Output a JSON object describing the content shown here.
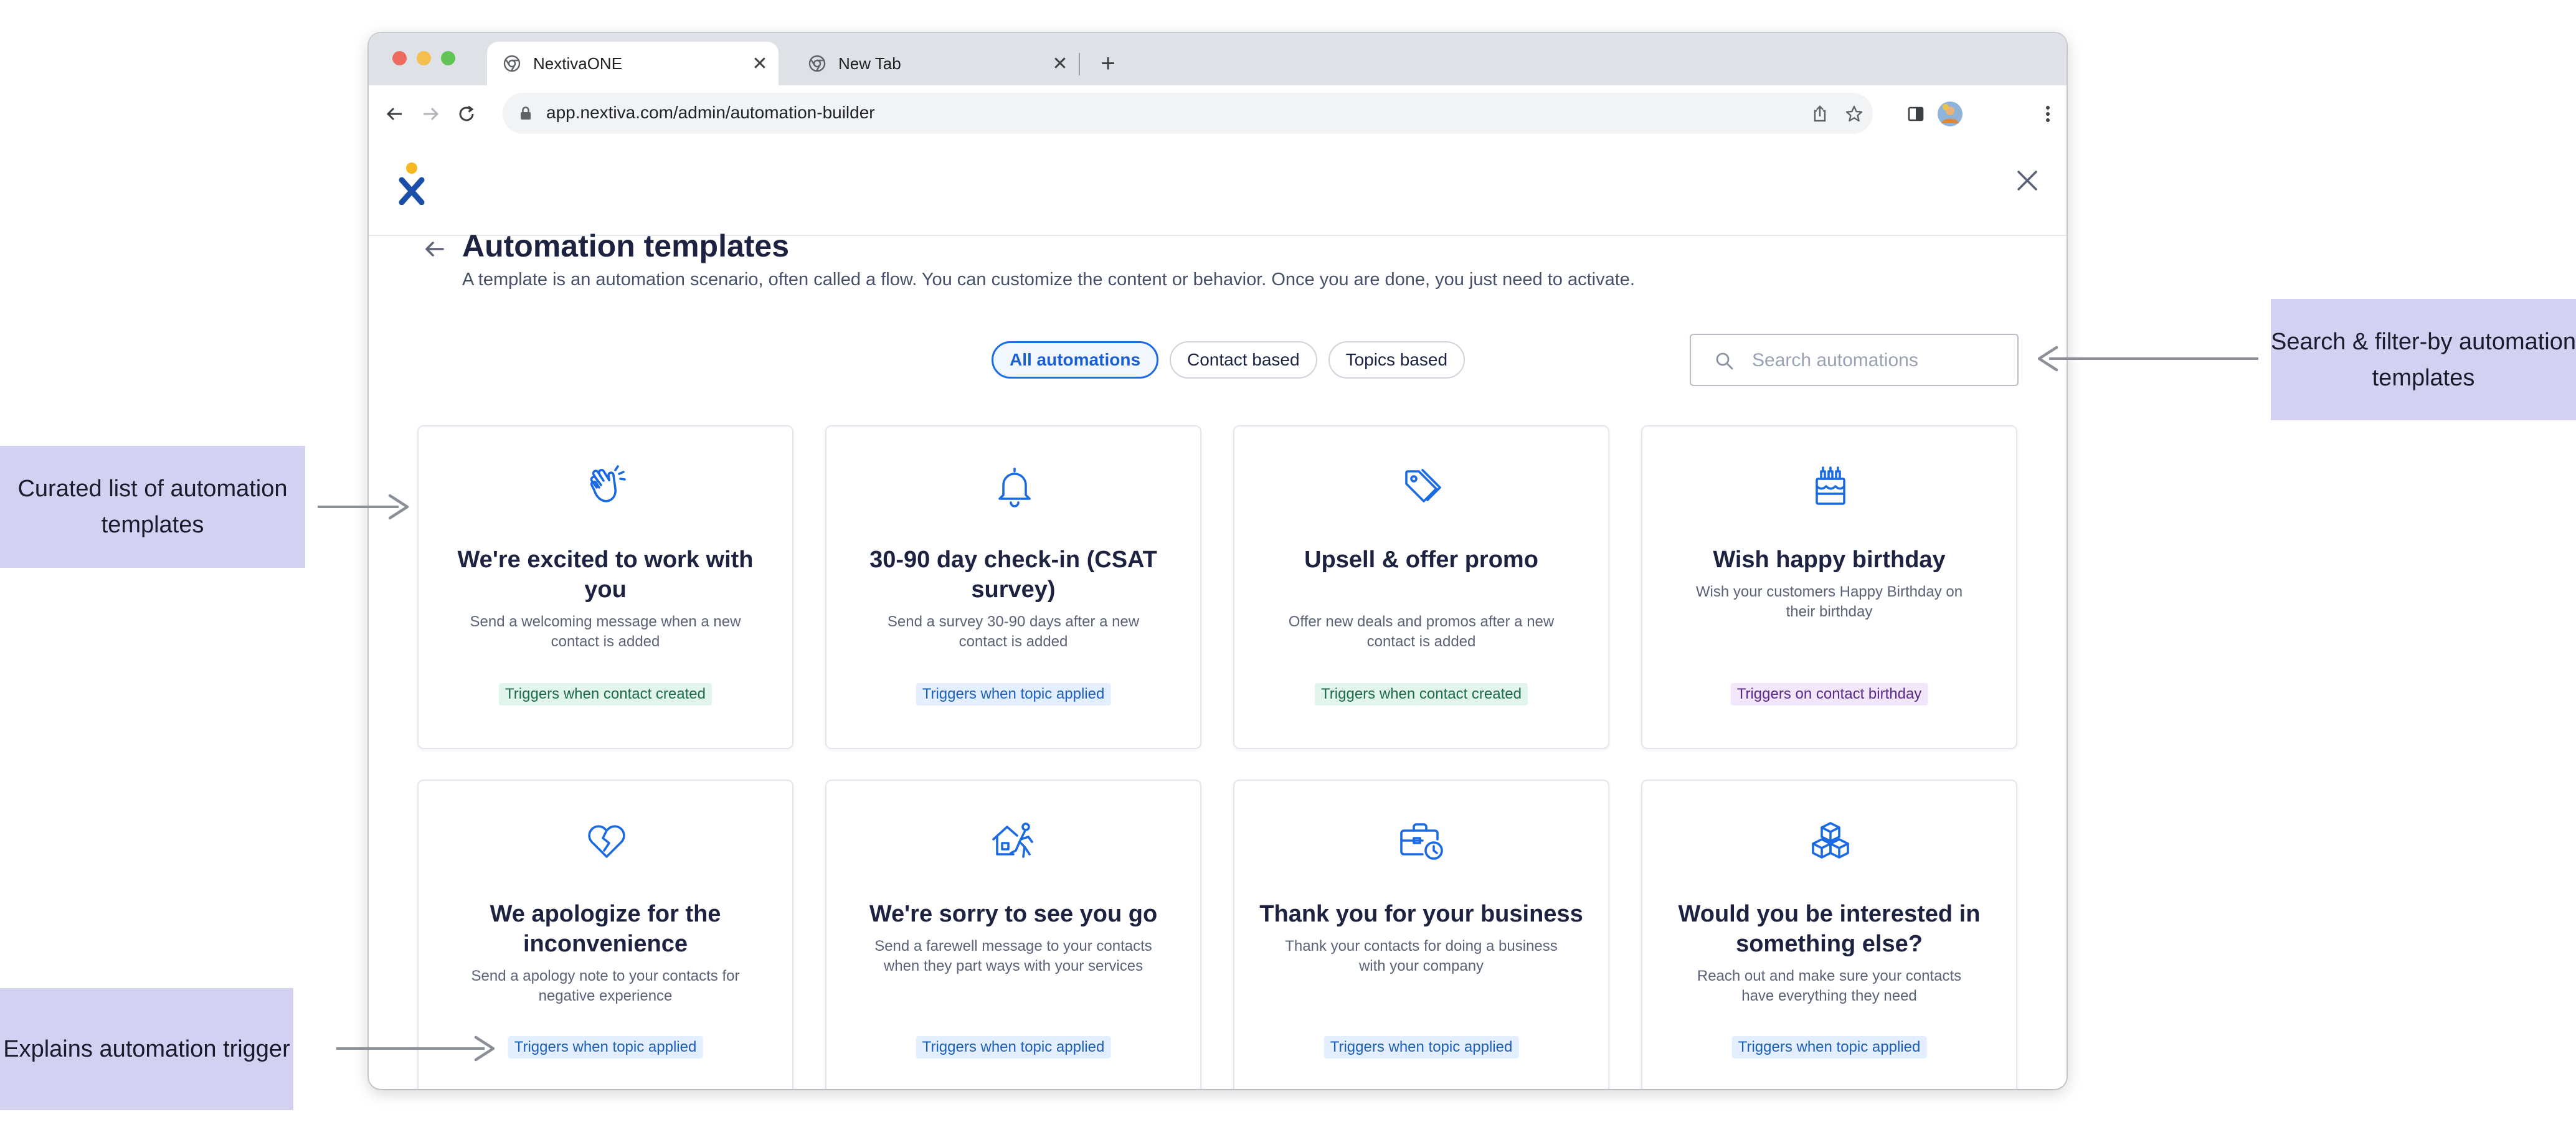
{
  "browser": {
    "tabs": [
      {
        "label": "NextivaONE",
        "active": true
      },
      {
        "label": "New Tab",
        "active": false
      }
    ],
    "url": "app.nextiva.com/admin/automation-builder"
  },
  "page": {
    "title": "Automation templates",
    "subtitle": "A template is an automation scenario, often called a flow. You can customize the content or behavior. Once you are done, you just need to activate.",
    "filters": [
      {
        "label": "All automations",
        "active": true
      },
      {
        "label": "Contact based",
        "active": false
      },
      {
        "label": "Topics based",
        "active": false
      }
    ],
    "search": {
      "placeholder": "Search automations",
      "value": ""
    }
  },
  "cards": [
    {
      "icon": "clapping-hands-icon",
      "title": "We're excited to work with you",
      "description": "Send a welcoming message when a new contact is added",
      "trigger": "Triggers when contact created",
      "trigger_color": "green"
    },
    {
      "icon": "bell-icon",
      "title": "30-90 day check-in (CSAT survey)",
      "description": "Send a survey 30-90 days after a new contact is added",
      "trigger": "Triggers when topic applied",
      "trigger_color": "blue"
    },
    {
      "icon": "tag-icon",
      "title": "Upsell & offer promo",
      "description": "Offer new deals and promos after a new contact is added",
      "trigger": "Triggers when contact created",
      "trigger_color": "green"
    },
    {
      "icon": "birthday-cake-icon",
      "title": "Wish happy birthday",
      "description": "Wish your customers Happy Birthday on their birthday",
      "trigger": "Triggers on contact birthday",
      "trigger_color": "purple"
    },
    {
      "icon": "broken-heart-icon",
      "title": "We apologize for the inconvenience",
      "description": "Send a apology note to your contacts for negative experience",
      "trigger": "Triggers when topic applied",
      "trigger_color": "blue"
    },
    {
      "icon": "house-walking-person-icon",
      "title": "We're sorry to see you go",
      "description": "Send a farewell message to your contacts when they part ways with your services",
      "trigger": "Triggers when topic applied",
      "trigger_color": "blue"
    },
    {
      "icon": "briefcase-clock-icon",
      "title": "Thank you for your business",
      "description": "Thank your contacts for doing a business with your company",
      "trigger": "Triggers when topic applied",
      "trigger_color": "blue"
    },
    {
      "icon": "boxes-icon",
      "title": "Would you be interested in something else?",
      "description": "Reach out and make sure your contacts have everything they need",
      "trigger": "Triggers when topic applied",
      "trigger_color": "blue"
    }
  ],
  "annotations": {
    "curated": "Curated list of automation templates",
    "search": "Search & filter-by automation templates",
    "trigger": "Explains automation trigger"
  },
  "colors": {
    "accent": "#1a6ae3",
    "title_text": "#1c2240",
    "annotation_bg": "#d2d1f2",
    "badge_green": "#e2f5ec",
    "badge_blue": "#e3efff",
    "badge_purple": "#f1e6fa"
  }
}
